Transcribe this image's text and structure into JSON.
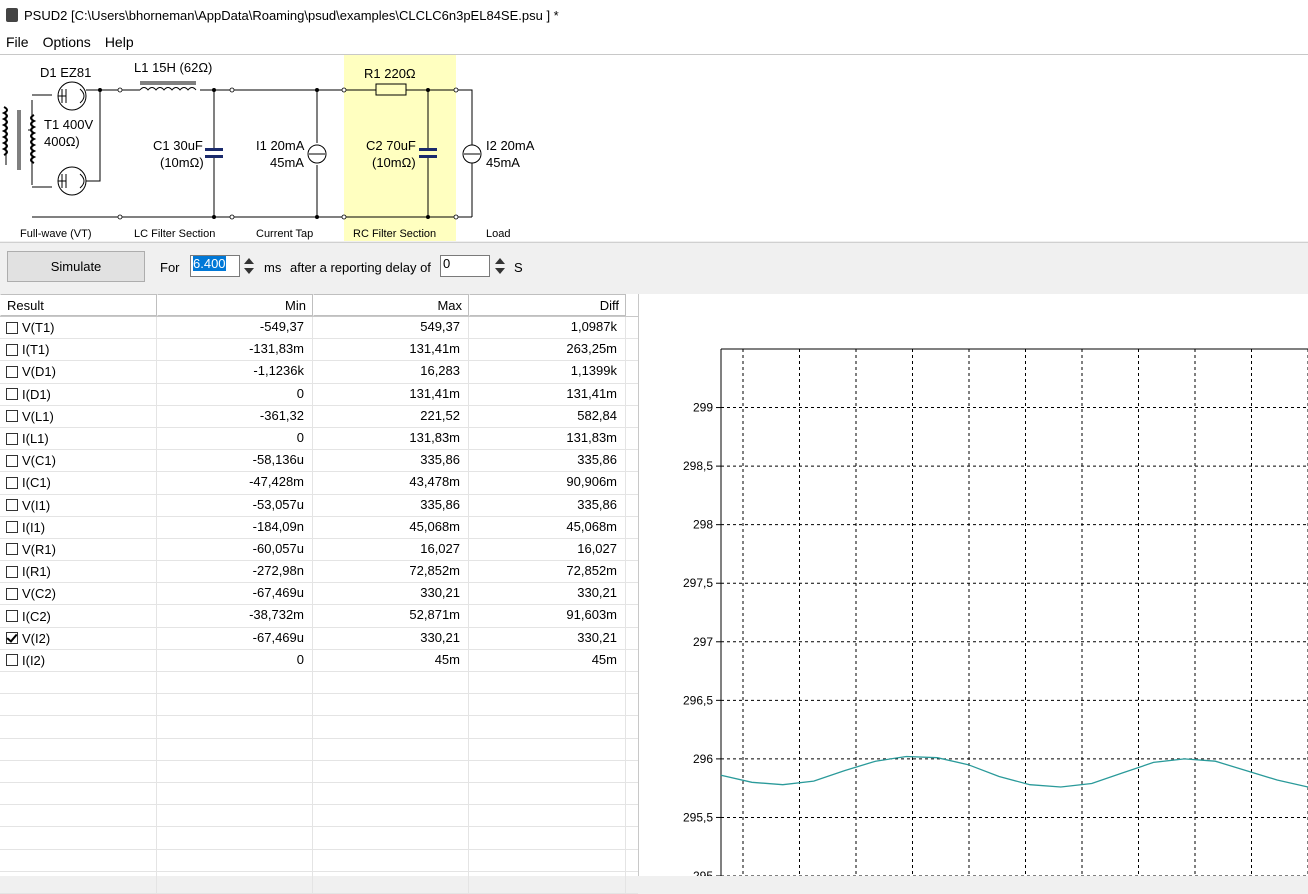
{
  "window": {
    "title": "PSUD2  [C:\\Users\\bhorneman\\AppData\\Roaming\\psud\\examples\\CLCLC6n3pEL84SE.psu ] *"
  },
  "menu": [
    "File",
    "Options",
    "Help"
  ],
  "schematic": {
    "d1": "D1 EZ81",
    "l1": "L1 15H (62Ω)",
    "r1": "R1 220Ω",
    "t1_a": "T1 400V",
    "t1_b": "400Ω)",
    "c1_a": "C1 30uF",
    "c1_b": "(10mΩ)",
    "i1_a": "I1 20mA",
    "i1_b": "45mA",
    "c2_a": "C2 70uF",
    "c2_b": "(10mΩ)",
    "i2_a": "I2 20mA",
    "i2_b": "45mA",
    "sections": [
      "Full-wave (VT)",
      "LC Filter Section",
      "Current Tap",
      "RC Filter Section",
      "Load"
    ],
    "highlight_color": "#ffffc0"
  },
  "toolbar": {
    "simulate": "Simulate",
    "for_label": "For",
    "duration": "6.400",
    "ms_label": "ms",
    "delay_label": "after a reporting delay of",
    "delay": "0",
    "s_label": "S"
  },
  "table": {
    "headers": [
      "Result",
      "Min",
      "Max",
      "Diff"
    ],
    "rows": [
      {
        "name": "V(T1)",
        "min": "-549,37",
        "max": "549,37",
        "diff": "1,0987k",
        "checked": false
      },
      {
        "name": "I(T1)",
        "min": "-131,83m",
        "max": "131,41m",
        "diff": "263,25m",
        "checked": false
      },
      {
        "name": "V(D1)",
        "min": "-1,1236k",
        "max": "16,283",
        "diff": "1,1399k",
        "checked": false
      },
      {
        "name": "I(D1)",
        "min": "0",
        "max": "131,41m",
        "diff": "131,41m",
        "checked": false
      },
      {
        "name": "V(L1)",
        "min": "-361,32",
        "max": "221,52",
        "diff": "582,84",
        "checked": false
      },
      {
        "name": "I(L1)",
        "min": "0",
        "max": "131,83m",
        "diff": "131,83m",
        "checked": false
      },
      {
        "name": "V(C1)",
        "min": "-58,136u",
        "max": "335,86",
        "diff": "335,86",
        "checked": false
      },
      {
        "name": "I(C1)",
        "min": "-47,428m",
        "max": "43,478m",
        "diff": "90,906m",
        "checked": false
      },
      {
        "name": "V(I1)",
        "min": "-53,057u",
        "max": "335,86",
        "diff": "335,86",
        "checked": false
      },
      {
        "name": "I(I1)",
        "min": "-184,09n",
        "max": "45,068m",
        "diff": "45,068m",
        "checked": false
      },
      {
        "name": "V(R1)",
        "min": "-60,057u",
        "max": "16,027",
        "diff": "16,027",
        "checked": false
      },
      {
        "name": "I(R1)",
        "min": "-272,98n",
        "max": "72,852m",
        "diff": "72,852m",
        "checked": false
      },
      {
        "name": "V(C2)",
        "min": "-67,469u",
        "max": "330,21",
        "diff": "330,21",
        "checked": false
      },
      {
        "name": "I(C2)",
        "min": "-38,732m",
        "max": "52,871m",
        "diff": "91,603m",
        "checked": false
      },
      {
        "name": "V(I2)",
        "min": "-67,469u",
        "max": "330,21",
        "diff": "330,21",
        "checked": true
      },
      {
        "name": "I(I2)",
        "min": "0",
        "max": "45m",
        "diff": "45m",
        "checked": false
      }
    ]
  },
  "chart_data": {
    "type": "line",
    "title": "",
    "xlabel": "",
    "ylabel": "",
    "yticks": [
      "299",
      "298,5",
      "298",
      "297,5",
      "297",
      "296,5",
      "296",
      "295,5",
      "295"
    ],
    "ylim": [
      295,
      299.5
    ],
    "grid": true,
    "series": [
      {
        "color": "#2a9a9a",
        "values": [
          295.86,
          295.8,
          295.78,
          295.81,
          295.9,
          295.98,
          296.02,
          296.01,
          295.95,
          295.85,
          295.78,
          295.76,
          295.79,
          295.88,
          295.97,
          296.0,
          295.98,
          295.9,
          295.82,
          295.76
        ]
      }
    ]
  }
}
